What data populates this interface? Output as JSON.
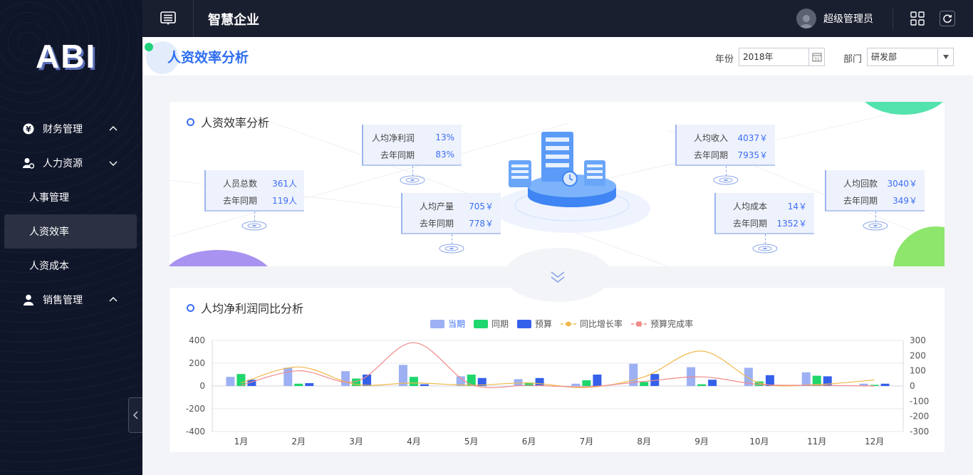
{
  "sidebar": {
    "logo": "ABI",
    "menu": [
      {
        "label": "财务管理"
      },
      {
        "label": "人力资源"
      },
      {
        "label": "销售管理"
      }
    ],
    "hr_sub": [
      {
        "label": "人事管理"
      },
      {
        "label": "人资效率"
      },
      {
        "label": "人资成本"
      }
    ],
    "active": "人资效率"
  },
  "topbar": {
    "title": "智慧企业",
    "user": "超级管理员"
  },
  "header": {
    "page_title": "人资效率分析",
    "year_label": "年份",
    "year_value": "2018年",
    "dept_label": "部门",
    "dept_value": "研发部"
  },
  "overview": {
    "title": "人资效率分析",
    "stats": [
      {
        "name": "人员总数",
        "value": "361人",
        "prev_label": "去年同期",
        "prev_value": "119人"
      },
      {
        "name": "人均净利润",
        "value": "13%",
        "prev_label": "去年同期",
        "prev_value": "83%"
      },
      {
        "name": "人均产量",
        "value": "705￥",
        "prev_label": "去年同期",
        "prev_value": "778￥"
      },
      {
        "name": "人均收入",
        "value": "4037￥",
        "prev_label": "去年同期",
        "prev_value": "7935￥"
      },
      {
        "name": "人均成本",
        "value": "14￥",
        "prev_label": "去年同期",
        "prev_value": "1352￥"
      },
      {
        "name": "人均回款",
        "value": "3040￥",
        "prev_label": "去年同期",
        "prev_value": "349￥"
      }
    ]
  },
  "chart_section": {
    "title": "人均净利润同比分析"
  },
  "chart_data": {
    "type": "bar",
    "categories": [
      "1月",
      "2月",
      "3月",
      "4月",
      "5月",
      "6月",
      "7月",
      "8月",
      "9月",
      "10月",
      "11月",
      "12月"
    ],
    "series": [
      {
        "name": "当期",
        "type": "bar",
        "color": "#9db0f3",
        "values": [
          80,
          160,
          130,
          185,
          85,
          60,
          20,
          195,
          165,
          160,
          120,
          20
        ]
      },
      {
        "name": "同期",
        "type": "bar",
        "color": "#1fd66c",
        "values": [
          105,
          20,
          65,
          80,
          100,
          30,
          50,
          35,
          15,
          40,
          90,
          10
        ]
      },
      {
        "name": "预算",
        "type": "bar",
        "color": "#3560ea",
        "values": [
          55,
          25,
          100,
          15,
          70,
          70,
          100,
          105,
          55,
          95,
          85,
          20
        ]
      },
      {
        "name": "同比增长率",
        "type": "line",
        "axis": "right",
        "color": "#f0b84a",
        "values": [
          20,
          125,
          10,
          20,
          5,
          20,
          -10,
          60,
          230,
          20,
          10,
          40
        ]
      },
      {
        "name": "预算完成率",
        "type": "line",
        "axis": "right",
        "color": "#f08a8a",
        "values": [
          5,
          100,
          30,
          285,
          10,
          5,
          -5,
          30,
          60,
          10,
          5,
          0
        ]
      }
    ],
    "ylim": [
      -400,
      400
    ],
    "yticks": [
      "400",
      "200",
      "0",
      "-200",
      "-400"
    ],
    "y2lim": [
      -300,
      300
    ],
    "y2ticks": [
      "300",
      "200",
      "100",
      "0",
      "-100",
      "-200",
      "-300"
    ],
    "legend_position": "top"
  }
}
